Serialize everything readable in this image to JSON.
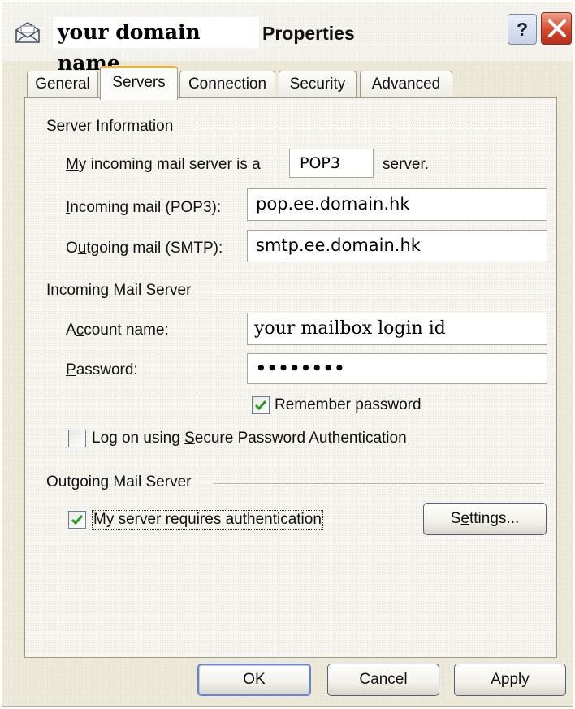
{
  "window": {
    "title_name": "your domain name",
    "title_suffix": "Properties",
    "help_label": "?",
    "title_icon": "mail-envelope-icon",
    "close_icon": "close-icon"
  },
  "tabs": [
    {
      "label": "General",
      "active": false
    },
    {
      "label": "Servers",
      "active": true
    },
    {
      "label": "Connection",
      "active": false
    },
    {
      "label": "Security",
      "active": false
    },
    {
      "label": "Advanced",
      "active": false
    }
  ],
  "server_info": {
    "group_label": "Server Information",
    "incoming_type_prefix": "My incoming mail server is a",
    "incoming_type_value": "POP3",
    "incoming_type_suffix": "server.",
    "incoming_label": "Incoming mail (POP3):",
    "incoming_value": "pop.ee.domain.hk",
    "outgoing_label": "Outgoing mail (SMTP):",
    "outgoing_value": "smtp.ee.domain.hk"
  },
  "incoming_server": {
    "group_label": "Incoming Mail Server",
    "account_label": "Account name:",
    "account_value": "your mailbox login id",
    "password_label": "Password:",
    "password_value": "••••••••",
    "remember_label": "Remember password",
    "remember_checked": true,
    "spa_label": "Log on using Secure Password Authentication",
    "spa_checked": false
  },
  "outgoing_server": {
    "group_label": "Outgoing Mail Server",
    "auth_label": "My server requires authentication",
    "auth_checked": true,
    "settings_label": "Settings..."
  },
  "footer": {
    "ok_label": "OK",
    "cancel_label": "Cancel",
    "apply_label": "Apply"
  }
}
